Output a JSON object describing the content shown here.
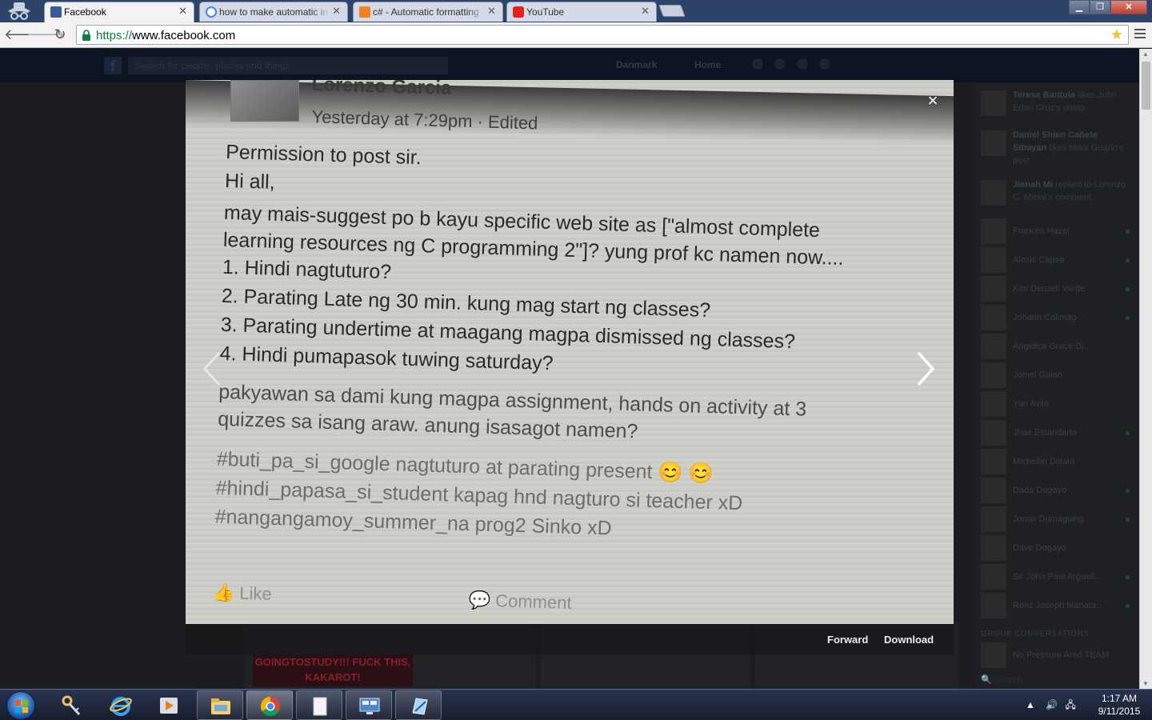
{
  "browser": {
    "tabs": [
      {
        "title": "Facebook",
        "favicon": "facebook-icon",
        "active": true
      },
      {
        "title": "how to make automatic in",
        "favicon": "google-icon",
        "active": false
      },
      {
        "title": "c# - Automatic formatting",
        "favicon": "stackoverflow-icon",
        "active": false
      },
      {
        "title": "YouTube",
        "favicon": "youtube-icon",
        "active": false
      }
    ],
    "url_scheme": "https://",
    "url_host": "www.facebook.com",
    "accent": "#2d4468"
  },
  "facebook": {
    "search_placeholder": "Search for people, places and things",
    "user_name": "Danmark",
    "home_label": "Home",
    "notifications": [
      {
        "name": "Teresa Bantula",
        "text": " likes John Erbin Cruz's photo."
      },
      {
        "name": "Daniel Shien Cañete Sibayan",
        "text": " likes Mark Guaño's post."
      },
      {
        "name": "Jienah Mi",
        "text": " replied to Lorenzo C. Micial's comment."
      }
    ],
    "chat_contacts": [
      "Frances Hazel",
      "Alexis Capsa",
      "Kim Denzell Varde",
      "Johann Calimag",
      "Angelica Grace Di...",
      "Jomel Guiao",
      "Yan Avila",
      "Jhae Estandarte",
      "Michellin Dalalo",
      "Dada Dogayo",
      "Jonas Dumaguing",
      "Dave Dogayo",
      "Sir John Paul Arguell...",
      "Renz Joseph Manata..."
    ],
    "group_conversations_label": "GROUP CONVERSATIONS",
    "group_name": "No Pressure Ared TEAM",
    "chat_search": "Search",
    "background_image_text": "GOINGTOSTUDY!!! FUCK THIS, KAKAROT!"
  },
  "photo": {
    "author": "Lorenzo Garcia",
    "timestamp": "Yesterday at 7:29pm · Edited",
    "lines": [
      "Permission to post sir.",
      "Hi all,",
      "may mais-suggest po b kayu specific web site as [\"almost complete",
      "learning resources ng C programming 2\"]? yung prof kc namen now....",
      "1. Hindi nagtuturo?",
      "2. Parating Late ng 30 min. kung mag start ng classes?",
      "3. Parating undertime at maagang magpa dismissed ng classes?",
      "4. Hindi pumapasok tuwing saturday?",
      "pakyawan sa dami kung magpa assignment, hands on activity at 3",
      "quizzes sa isang araw. anung isasagot namen?",
      "#buti_pa_si_google nagtuturo at parating present 😊 😊",
      "#hindi_papasa_si_student kapag hnd nagturo si teacher  xD",
      "#nangangamoy_summer_na prog2 Sinko xD"
    ],
    "like_label": "Like",
    "comment_label": "Comment"
  },
  "viewer": {
    "close_label": "×",
    "forward_label": "Forward",
    "download_label": "Download"
  },
  "taskbar": {
    "time": "1:17 AM",
    "date": "9/11/2015"
  }
}
